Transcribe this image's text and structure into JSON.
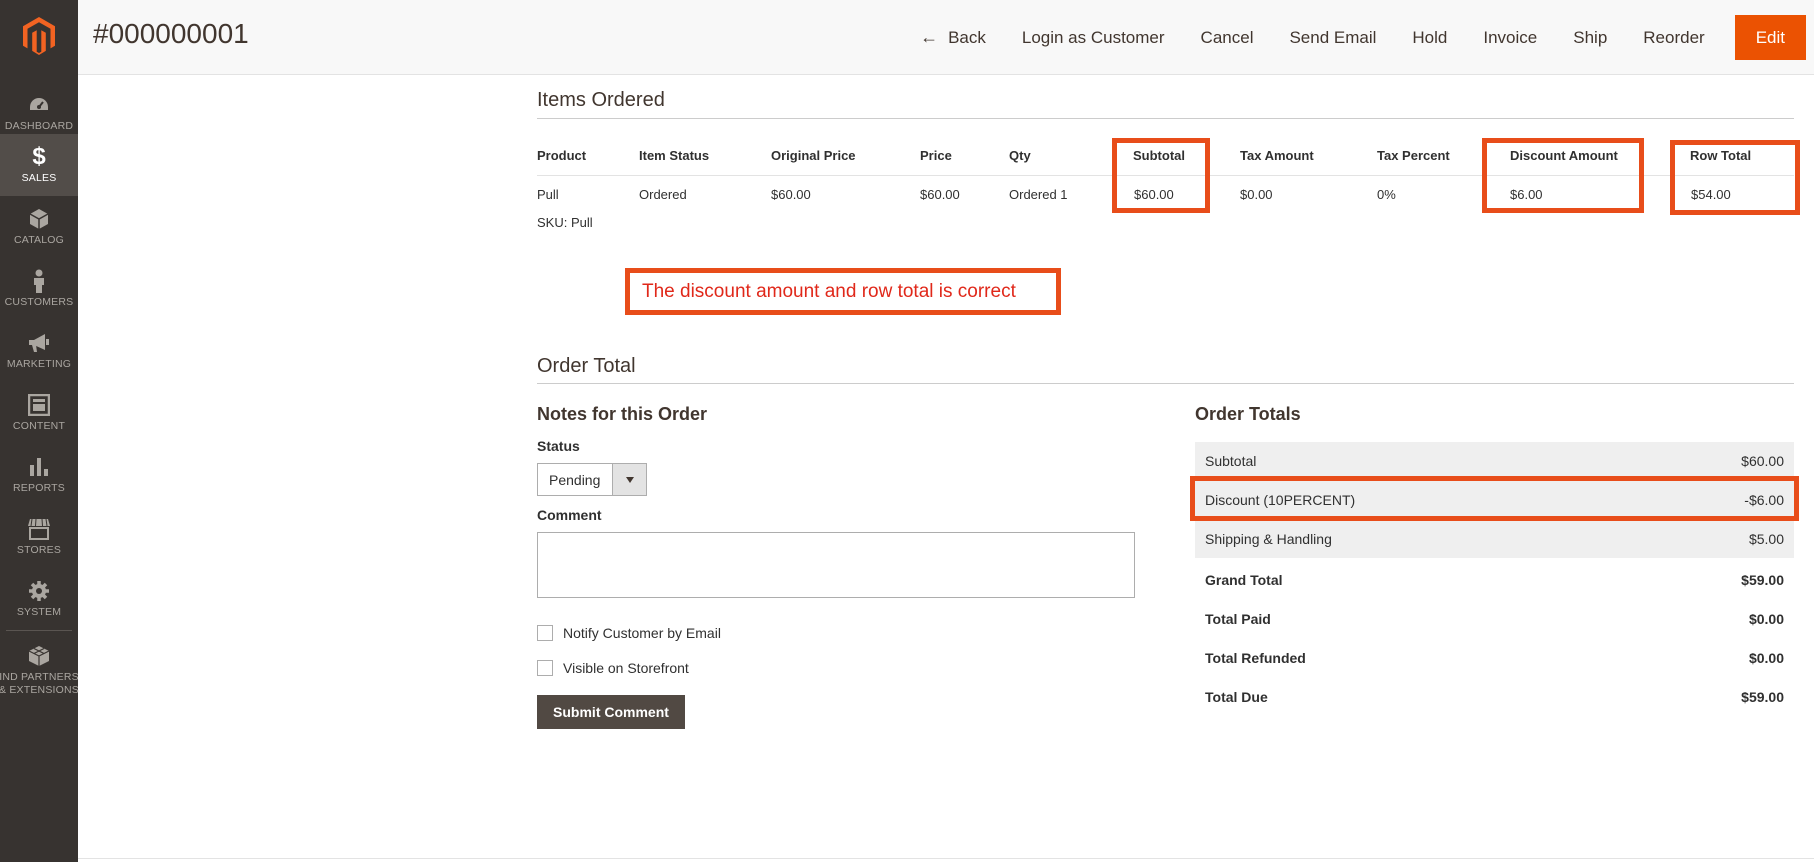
{
  "sidebar": {
    "items": [
      {
        "label": "DASHBOARD",
        "icon": "dashboard-icon"
      },
      {
        "label": "SALES",
        "icon": "dollar-icon"
      },
      {
        "label": "CATALOG",
        "icon": "cube-icon"
      },
      {
        "label": "CUSTOMERS",
        "icon": "person-icon"
      },
      {
        "label": "MARKETING",
        "icon": "megaphone-icon"
      },
      {
        "label": "CONTENT",
        "icon": "layout-icon"
      },
      {
        "label": "REPORTS",
        "icon": "bar-chart-icon"
      },
      {
        "label": "STORES",
        "icon": "store-icon"
      },
      {
        "label": "SYSTEM",
        "icon": "gear-icon"
      },
      {
        "label": "FIND PARTNERS & EXTENSIONS",
        "line1": "IND PARTNERS",
        "line2": "& EXTENSIONS",
        "icon": "boxes-icon"
      }
    ],
    "active": "SALES"
  },
  "header": {
    "title": "#000000001",
    "actions": {
      "back": "Back",
      "login_as_customer": "Login as Customer",
      "cancel": "Cancel",
      "send_email": "Send Email",
      "hold": "Hold",
      "invoice": "Invoice",
      "ship": "Ship",
      "reorder": "Reorder",
      "edit": "Edit"
    }
  },
  "items_ordered": {
    "title": "Items Ordered",
    "columns": {
      "product": "Product",
      "item_status": "Item Status",
      "original_price": "Original Price",
      "price": "Price",
      "qty": "Qty",
      "subtotal": "Subtotal",
      "tax_amount": "Tax Amount",
      "tax_percent": "Tax Percent",
      "discount_amount": "Discount Amount",
      "row_total": "Row Total"
    },
    "row": {
      "product": "Pull",
      "sku": "SKU: Pull",
      "item_status": "Ordered",
      "original_price": "$60.00",
      "price": "$60.00",
      "qty": "Ordered 1",
      "subtotal": "$60.00",
      "tax_amount": "$0.00",
      "tax_percent": "0%",
      "discount_amount": "$6.00",
      "row_total": "$54.00"
    }
  },
  "annotation": {
    "text": "The discount amount and row total is correct",
    "color": "#e84d1a"
  },
  "order_total": {
    "title": "Order Total",
    "notes": {
      "title": "Notes for this Order",
      "status_label": "Status",
      "status_value": "Pending",
      "comment_label": "Comment",
      "comment_value": "",
      "notify_label": "Notify Customer by Email",
      "visible_label": "Visible on Storefront",
      "submit_label": "Submit Comment"
    },
    "totals": {
      "title": "Order Totals",
      "rows": [
        {
          "label": "Subtotal",
          "value": "$60.00"
        },
        {
          "label": "Discount (10PERCENT)",
          "value": "-$6.00"
        },
        {
          "label": "Shipping & Handling",
          "value": "$5.00"
        },
        {
          "label": "Grand Total",
          "value": "$59.00"
        },
        {
          "label": "Total Paid",
          "value": "$0.00"
        },
        {
          "label": "Total Refunded",
          "value": "$0.00"
        },
        {
          "label": "Total Due",
          "value": "$59.00"
        }
      ]
    }
  },
  "colors": {
    "accent": "#eb5202",
    "sidebar_bg": "#373330",
    "highlight_box": "#e84d1a"
  }
}
